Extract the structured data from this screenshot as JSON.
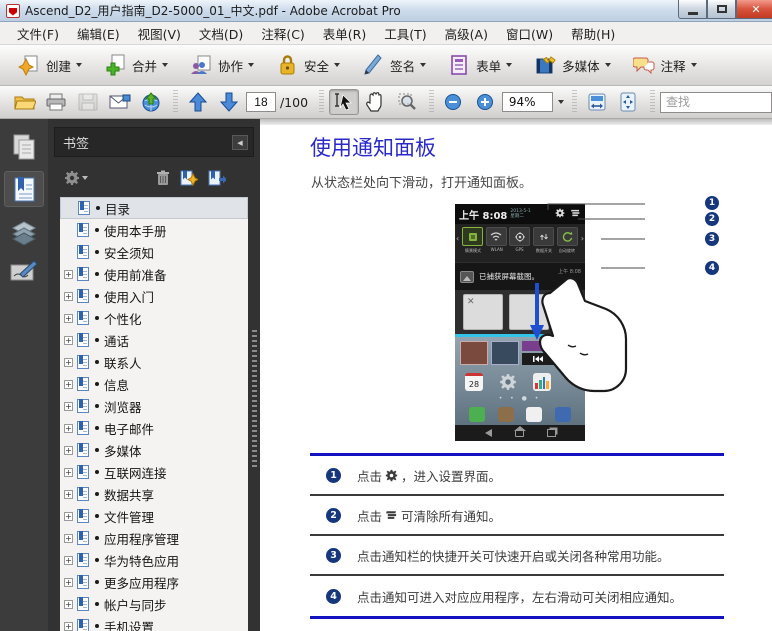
{
  "window": {
    "title": "Ascend_D2_用户指南_D2-5000_01_中文.pdf - Adobe Acrobat Pro"
  },
  "menu": {
    "items": [
      "文件(F)",
      "编辑(E)",
      "视图(V)",
      "文档(D)",
      "注释(C)",
      "表单(R)",
      "工具(T)",
      "高级(A)",
      "窗口(W)",
      "帮助(H)"
    ]
  },
  "toolbar": {
    "buttons": [
      {
        "label": "创建"
      },
      {
        "label": "合并"
      },
      {
        "label": "协作"
      },
      {
        "label": "安全"
      },
      {
        "label": "签名"
      },
      {
        "label": "表单"
      },
      {
        "label": "多媒体"
      },
      {
        "label": "注释"
      }
    ]
  },
  "navbar": {
    "page_current": "18",
    "page_total": "/100",
    "zoom": "94%",
    "find_placeholder": "查找"
  },
  "panel": {
    "title": "书签"
  },
  "sidebar": {
    "items": [
      {
        "label": "目录"
      },
      {
        "label": "使用本手册"
      },
      {
        "label": "安全须知"
      },
      {
        "label": "使用前准备"
      },
      {
        "label": "使用入门"
      },
      {
        "label": "个性化"
      },
      {
        "label": "通话"
      },
      {
        "label": "联系人"
      },
      {
        "label": "信息"
      },
      {
        "label": "浏览器"
      },
      {
        "label": "电子邮件"
      },
      {
        "label": "多媒体"
      },
      {
        "label": "互联网连接"
      },
      {
        "label": "数据共享"
      },
      {
        "label": "文件管理"
      },
      {
        "label": "应用程序管理"
      },
      {
        "label": "华为特色应用"
      },
      {
        "label": "更多应用程序"
      },
      {
        "label": "帐户与同步"
      },
      {
        "label": "手机设置"
      }
    ]
  },
  "doc": {
    "heading": "使用通知面板",
    "intro": "从状态栏处向下滑动，打开通知面板。",
    "phone": {
      "time": "上午 8:08",
      "date": "2013-5-1",
      "weekday": "星期二",
      "toggles": [
        "情景模式",
        "WLAN",
        "GPS",
        "数据开关",
        "自动旋转"
      ],
      "notification": "已捕获屏幕截图。",
      "notification_time": "上午 8:08"
    },
    "callouts": [
      {
        "num": "1",
        "pre": "点击",
        "post": "，进入设置界面。"
      },
      {
        "num": "2",
        "pre": "点击",
        "post": "可清除所有通知。"
      },
      {
        "num": "3",
        "pre": "点击通知栏的快捷开关可快速开启或关闭各种常用功能。",
        "post": ""
      },
      {
        "num": "4",
        "pre": "点击通知可进入对应应用程序，左右滑动可关闭相应通知。",
        "post": ""
      }
    ]
  }
}
